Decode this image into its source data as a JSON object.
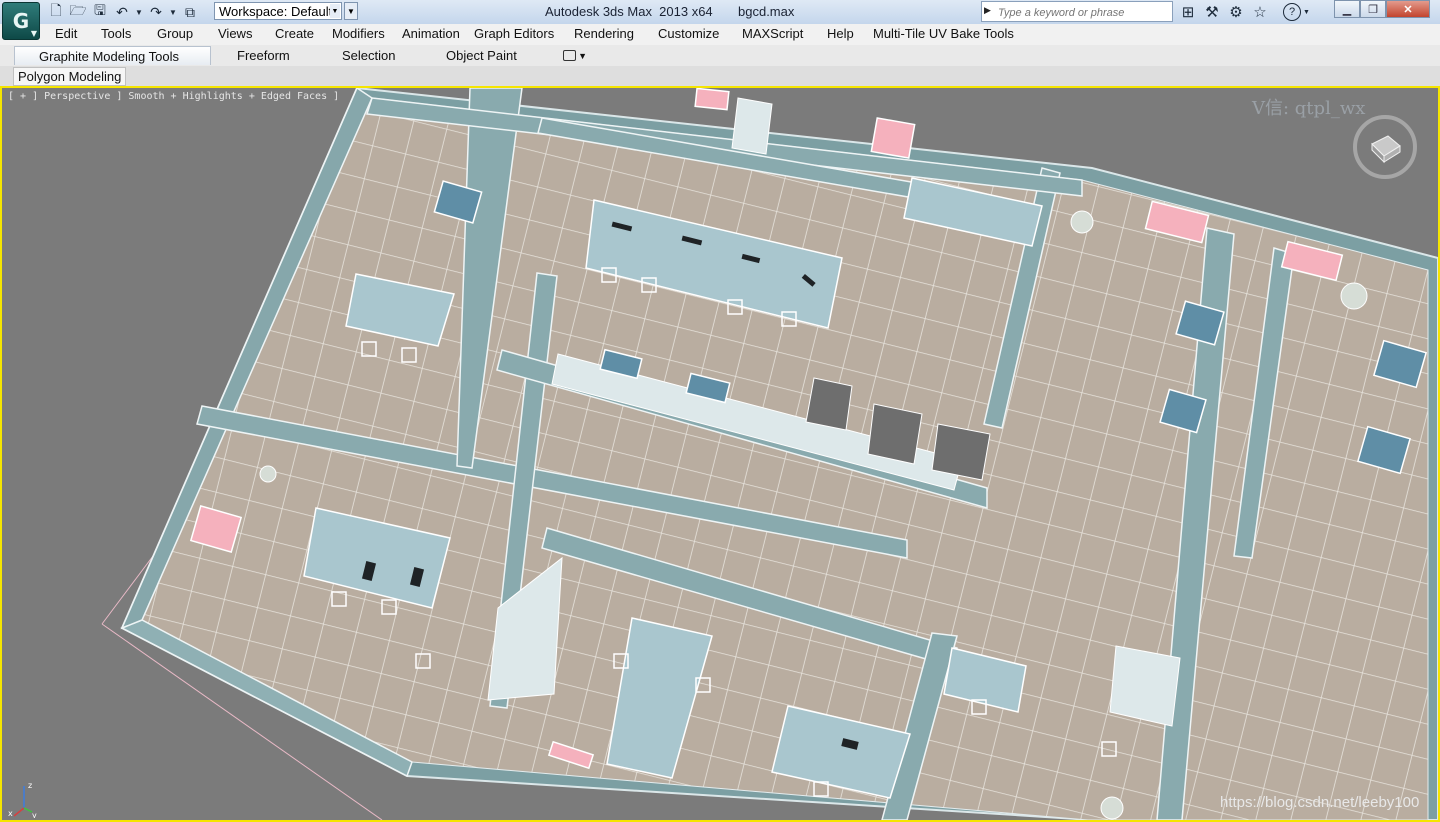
{
  "titlebar": {
    "app_name": "Autodesk 3ds Max  2013 x64",
    "file_name": "bgcd.max",
    "workspace": "Workspace: Default",
    "search_placeholder": "Type a keyword or phrase",
    "logo_glyph": "G",
    "quick_access_icons": [
      "new-file-icon",
      "open-file-icon",
      "save-icon",
      "undo-icon",
      "undo-dropdown-icon",
      "redo-icon",
      "redo-dropdown-icon",
      "project-folder-icon"
    ],
    "infocenter_icons": [
      "binoculars-icon",
      "search-tools-icon",
      "communication-icon",
      "favorites-star-icon"
    ],
    "help_glyph": "?",
    "window_controls": [
      "minimize-icon",
      "restore-icon",
      "close-icon"
    ]
  },
  "menu": {
    "items": [
      "Edit",
      "Tools",
      "Group",
      "Views",
      "Create",
      "Modifiers",
      "Animation",
      "Graph Editors",
      "Rendering",
      "Customize",
      "MAXScript",
      "Help",
      "Multi-Tile UV Bake Tools"
    ]
  },
  "ribbon": {
    "tabs": [
      "Graphite Modeling Tools",
      "Freeform",
      "Selection",
      "Object Paint"
    ],
    "active_tab": "Graphite Modeling Tools",
    "panel_label": "Polygon Modeling"
  },
  "viewport": {
    "label": "[ + ] Perspective ] Smooth + Highlights + Edged Faces ]",
    "watermark": "V信: qtpl_wx",
    "url_watermark": "https://blog.csdn.net/leeby100",
    "axis_labels": [
      "z",
      "x",
      "y"
    ],
    "border_color": "#f5e500",
    "background_color": "#7b7b7b"
  }
}
